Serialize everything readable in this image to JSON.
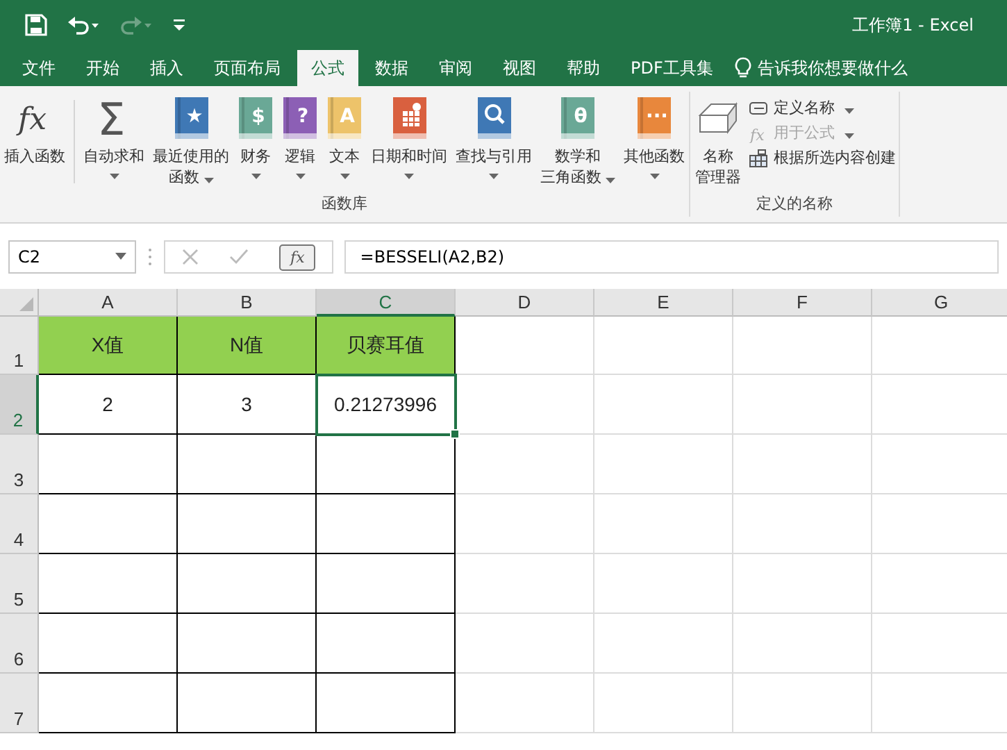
{
  "title_bar": {
    "title": "工作簿1  -  Excel"
  },
  "tabs": [
    {
      "label": "文件",
      "selected": false
    },
    {
      "label": "开始",
      "selected": false
    },
    {
      "label": "插入",
      "selected": false
    },
    {
      "label": "页面布局",
      "selected": false
    },
    {
      "label": "公式",
      "selected": true
    },
    {
      "label": "数据",
      "selected": false
    },
    {
      "label": "审阅",
      "selected": false
    },
    {
      "label": "视图",
      "selected": false
    },
    {
      "label": "帮助",
      "selected": false
    },
    {
      "label": "PDF工具集",
      "selected": false
    }
  ],
  "tell_me": {
    "label": "告诉我你想要做什么"
  },
  "ribbon": {
    "groups": [
      {
        "label": "函数库",
        "buttons": [
          {
            "lines": [
              "插入函数"
            ],
            "dropdown": false,
            "icon": {
              "kind": "fx",
              "glyph": "fx"
            }
          },
          {
            "lines": [
              "自动求和"
            ],
            "dropdown": true,
            "icon": {
              "kind": "sigma",
              "glyph": "Σ"
            }
          },
          {
            "lines": [
              "最近使用的",
              "函数"
            ],
            "dropdown": true,
            "icon": {
              "kind": "book",
              "color": "#3f78b5",
              "glyph": "★"
            }
          },
          {
            "lines": [
              "财务"
            ],
            "dropdown": true,
            "icon": {
              "kind": "book",
              "color": "#6aa896",
              "glyph": "$"
            }
          },
          {
            "lines": [
              "逻辑"
            ],
            "dropdown": true,
            "icon": {
              "kind": "book",
              "color": "#8c5fb5",
              "glyph": "?"
            }
          },
          {
            "lines": [
              "文本"
            ],
            "dropdown": true,
            "icon": {
              "kind": "book",
              "color": "#edc36a",
              "glyph": "A"
            }
          },
          {
            "lines": [
              "日期和时间"
            ],
            "dropdown": true,
            "icon": {
              "kind": "calendar",
              "color": "#d9603f"
            }
          },
          {
            "lines": [
              "查找与引用"
            ],
            "dropdown": true,
            "icon": {
              "kind": "search",
              "color": "#3f78b5"
            }
          },
          {
            "lines": [
              "数学和",
              "三角函数"
            ],
            "dropdown": true,
            "icon": {
              "kind": "book",
              "color": "#6aa896",
              "glyph": "θ"
            }
          },
          {
            "lines": [
              "其他函数"
            ],
            "dropdown": true,
            "icon": {
              "kind": "book",
              "color": "#e8873c",
              "glyph": "···"
            }
          }
        ]
      },
      {
        "label": "定义的名称",
        "buttons": [
          {
            "lines": [
              "名称",
              "管理器"
            ],
            "dropdown": false,
            "icon": {
              "kind": "tags"
            }
          }
        ],
        "small_buttons": [
          {
            "label": "定义名称",
            "dropdown": true,
            "disabled": false
          },
          {
            "label": "用于公式",
            "dropdown": true,
            "disabled": true
          },
          {
            "label": "根据所选内容创建",
            "dropdown": false,
            "disabled": false
          }
        ]
      }
    ]
  },
  "formula_bar": {
    "name_box": "C2",
    "fx": "fx",
    "formula": "=BESSELI(A2,B2)"
  },
  "sheet": {
    "columns": [
      {
        "label": "A",
        "selected": false
      },
      {
        "label": "B",
        "selected": false
      },
      {
        "label": "C",
        "selected": true
      },
      {
        "label": "D",
        "selected": false
      },
      {
        "label": "E",
        "selected": false
      },
      {
        "label": "F",
        "selected": false
      },
      {
        "label": "G",
        "selected": false
      }
    ],
    "rows": [
      {
        "label": "1",
        "selected": false,
        "cells": [
          {
            "text": "X值",
            "kind": "header",
            "selected": false
          },
          {
            "text": "N值",
            "kind": "header",
            "selected": false
          },
          {
            "text": "贝赛耳值",
            "kind": "header",
            "selected": false
          }
        ]
      },
      {
        "label": "2",
        "selected": true,
        "cells": [
          {
            "text": "2",
            "kind": "data",
            "selected": false
          },
          {
            "text": "3",
            "kind": "data",
            "selected": false
          },
          {
            "text": "0.21273996",
            "kind": "data",
            "selected": true
          }
        ]
      },
      {
        "label": "3",
        "selected": false,
        "cells": []
      },
      {
        "label": "4",
        "selected": false,
        "cells": []
      },
      {
        "label": "5",
        "selected": false,
        "cells": []
      },
      {
        "label": "6",
        "selected": false,
        "cells": []
      },
      {
        "label": "7",
        "selected": false,
        "cells": []
      }
    ]
  }
}
